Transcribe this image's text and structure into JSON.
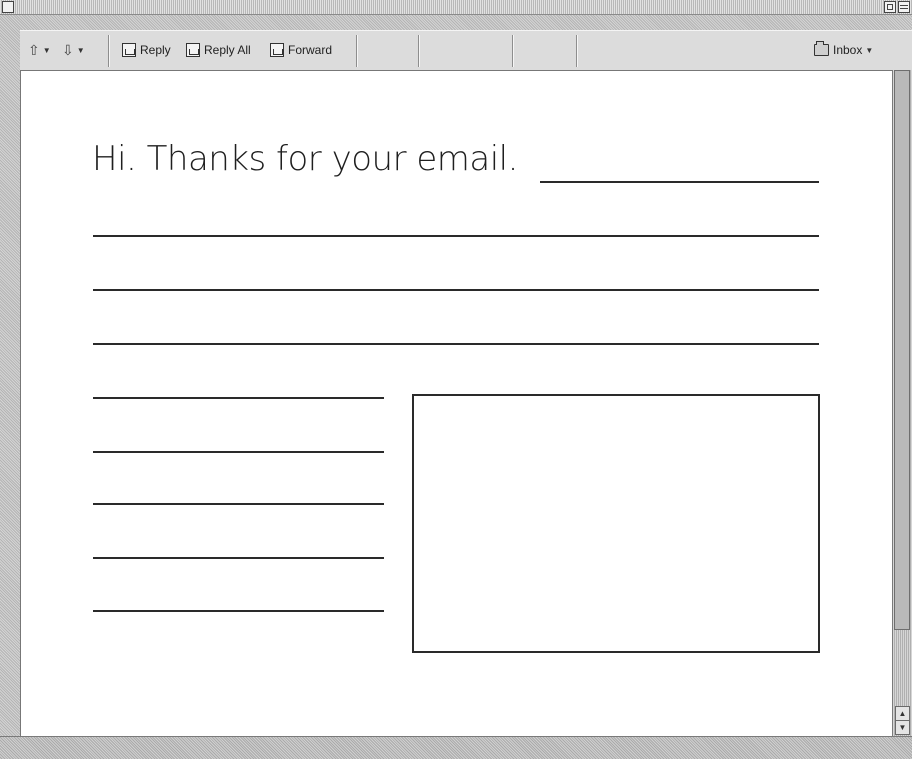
{
  "toolbar": {
    "reply_label": "Reply",
    "reply_all_label": "Reply All",
    "forward_label": "Forward",
    "mailbox_label": "Inbox",
    "icons": [
      "previous-message-icon",
      "next-message-icon",
      "reply-icon",
      "reply-all-icon",
      "forward-icon",
      "inbox-icon"
    ]
  },
  "message": {
    "greeting": "Hi. Thanks for your email."
  },
  "colors": {
    "chrome": "#c9c9c9",
    "toolbar": "#dcdcdc",
    "page": "#ffffff",
    "ink": "#2a2a2a"
  }
}
